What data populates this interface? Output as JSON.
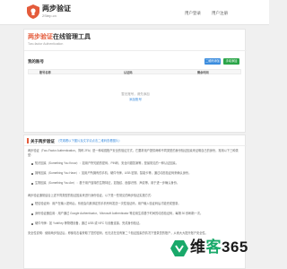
{
  "header": {
    "title": "两步验证",
    "subtitle": "2Step.cn",
    "nav": [
      "用户登录",
      "用户注册"
    ]
  },
  "main": {
    "title_highlight": "两步验证",
    "title_rest": "在线管理工具",
    "subtitle": "Two-factor Authentication",
    "section_label": "我的账号",
    "btn_scan": "二维码添加",
    "btn_manual": "手动添加",
    "columns": [
      "账号名称",
      "认证码",
      "剩余时间"
    ],
    "empty_text": "暂无账号，请先添加",
    "empty_link": "添加账号"
  },
  "about": {
    "title": "关于两步验证",
    "tip": "（凭观看以下图片及文字请点击二维码查看图片）",
    "intro": "两步验证（Two-Factor Authentication，简称 2FA）是一种增强账户安全的验证方式，它要求用户提供两种不同类型的身份验证因素来证明自己的身份，常用以下三种类型：",
    "bullets": [
      "知识因素（Something You Know）：如用户所知道的密码、PIN码、安全问题答案等，是最常见的一种认证因素。",
      "拥有因素（Something You Have）：如用户所拥有的手机、硬件令牌、USB 密钥、智能卡等，通过动态验证码来确认身份。",
      "生物因素（Something You Are）：基于用户独特的生物特征，如指纹、面部识别、声纹等，用于进一步确认身份。"
    ],
    "para2": "两步验证通常结合上述不同类型的验证因素来进行身份验证，以下是一些常见的两步验证实施方式：",
    "bullets2": [
      "短信验证码：用户在输入密码后，系统会向其绑定的手机号码发送一次性验证码，用户输入验证码后才能完成登录。",
      "身份验证器应用：用户通过 Google Authenticator、Microsoft Authenticator 等应用生成基于时间的动态验证码，每隔 30 秒刷新一次。",
      "硬件令牌：如 YubiKey 等物理设备，通过 USB 或 NFC 与设备连接，完成身份验证。"
    ],
    "para3": "安全性说明：使用两步验证后，即使攻击者获取了您的密码，也无法在没有第二个验证因素的情况下登录您的账户，从而大大提升账户安全性。"
  },
  "watermark": {
    "text_dark": "维",
    "text_green": "客",
    "text_dark2": "365"
  }
}
